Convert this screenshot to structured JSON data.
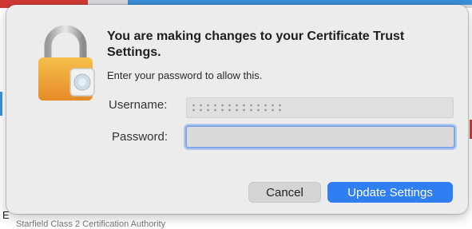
{
  "dialog": {
    "title": "You are making changes to your Certificate Trust Settings.",
    "subtitle": "Enter your password to allow this.",
    "icon": "lock-icon"
  },
  "form": {
    "username_label": "Username:",
    "username_value": "",
    "password_label": "Password:",
    "password_value": ""
  },
  "buttons": {
    "cancel_label": "Cancel",
    "update_label": "Update Settings"
  },
  "background": {
    "left_text": "E",
    "bottom_text": "Starfield Class 2 Certification Authority"
  },
  "colors": {
    "primary_button": "#2f7ef2",
    "focus_ring": "#7fa6e8",
    "lock_body": "#f0a63a"
  }
}
